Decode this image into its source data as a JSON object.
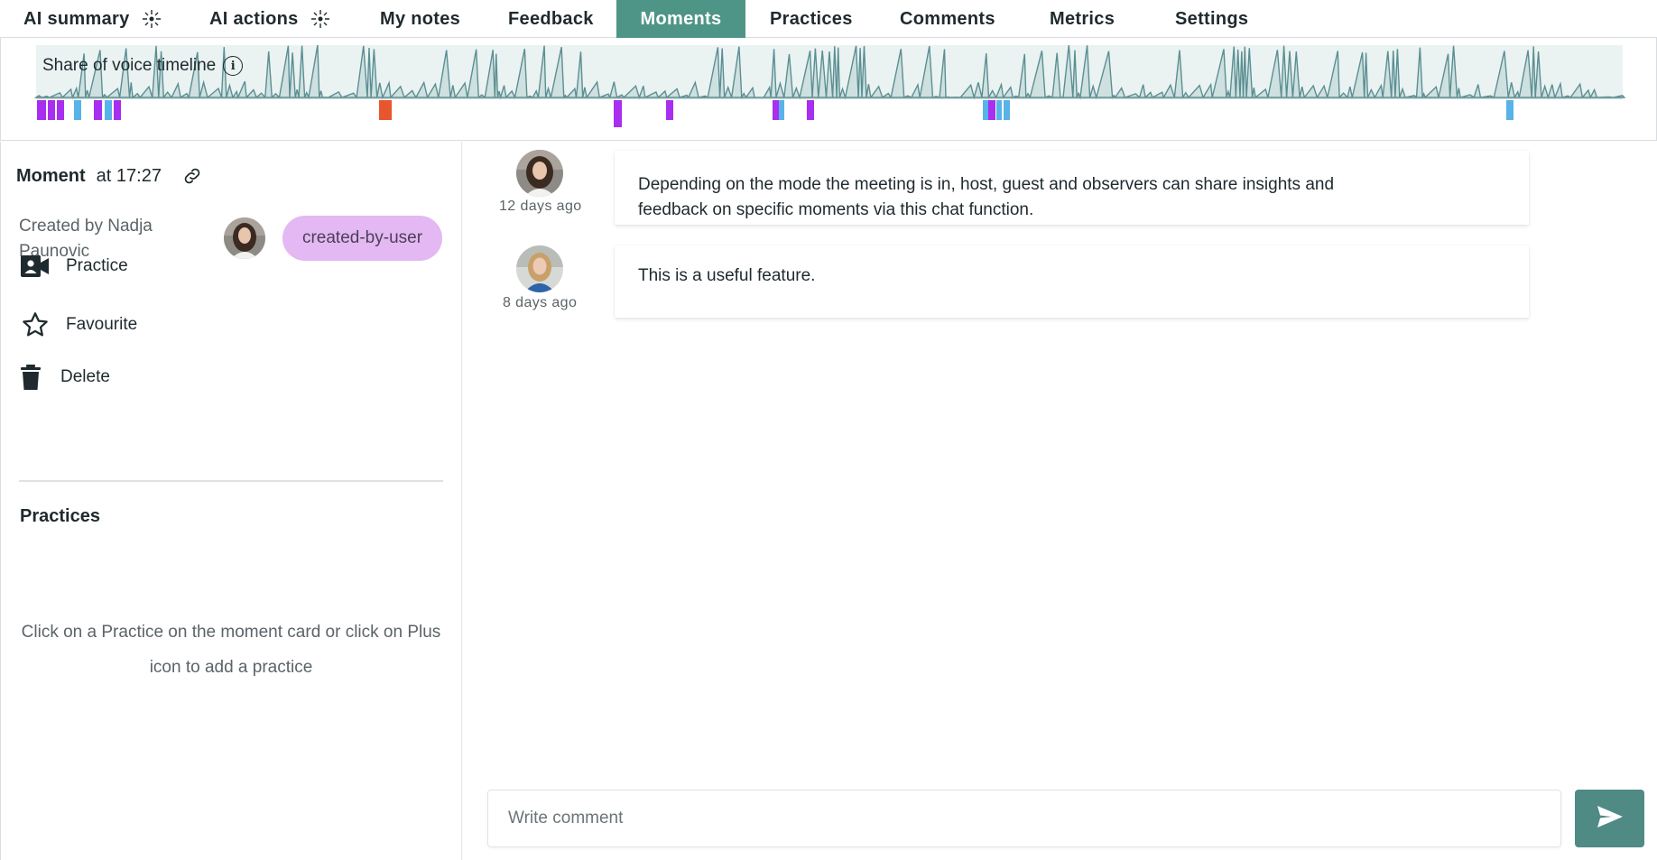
{
  "tabs": [
    {
      "label": "AI summary",
      "sparkle": true
    },
    {
      "label": "AI actions",
      "sparkle": true
    },
    {
      "label": "My notes"
    },
    {
      "label": "Feedback"
    },
    {
      "label": "Moments",
      "active": true
    },
    {
      "label": "Practices"
    },
    {
      "label": "Comments"
    },
    {
      "label": "Metrics"
    },
    {
      "label": "Settings"
    }
  ],
  "timeline": {
    "label": "Share of voice timeline",
    "info_icon": "info-icon",
    "colors": {
      "fill": "#cfe0e0",
      "line": "#5b8f92",
      "purple": "#a82ef0",
      "blue": "#57b3e8",
      "orange": "#e8562e"
    }
  },
  "moment": {
    "title": "Moment",
    "time": "at 17:27",
    "link_icon": "link-icon",
    "created_by": "Created by Nadja Paunovic",
    "tag": "created-by-user",
    "actions": [
      {
        "label": "Practice",
        "icon": "video-user-icon"
      },
      {
        "label": "Favourite",
        "icon": "star-icon"
      },
      {
        "label": "Delete",
        "icon": "trash-icon"
      }
    ],
    "practices_heading": "Practices",
    "practices_empty": "Click on a Practice on the moment card or click on Plus icon to add a practice"
  },
  "comments": [
    {
      "ago": "12 days ago",
      "text": "Depending on the mode the meeting is in, host, guest and observers can share insights and feedback on specific moments via this chat function."
    },
    {
      "ago": "8 days ago",
      "text": "This is a useful feature."
    }
  ],
  "composer": {
    "placeholder": "Write comment",
    "send_icon": "send-icon"
  },
  "accent": "#4f9587"
}
